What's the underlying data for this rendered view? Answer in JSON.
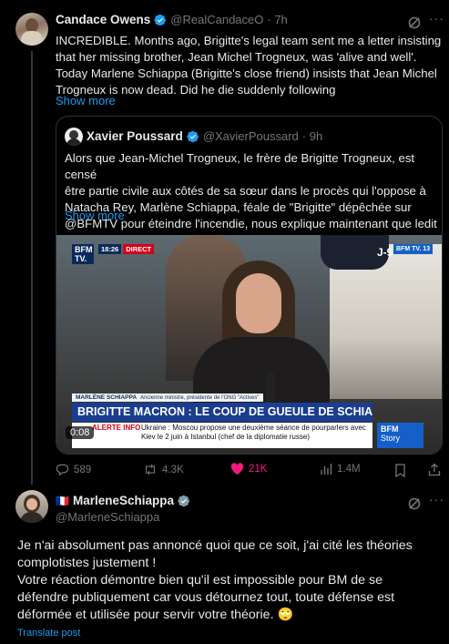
{
  "tweet": {
    "author_name": "Candace Owens",
    "author_handle": "@RealCandaceO",
    "time": "· 7h",
    "text_lines": [
      "INCREDIBLE. Months ago, Brigitte's legal team sent me a letter insisting",
      "that her missing brother, Jean Michel Trogneux, was 'alive and well'.",
      "Today Marlene Schiappa (Brigitte's close friend) insists that Jean Michel",
      "Trogneux is now dead. Did he die suddenly following"
    ],
    "show_more": "Show more",
    "quote": {
      "author_name": "Xavier Poussard",
      "author_handle": "@XavierPoussard",
      "time": "· 9h",
      "text_lines": [
        "Alors que Jean-Michel Trogneux, le frère de Brigitte Trogneux, est censé",
        "être partie civile aux côtés de sa sœur dans le procès qui l'oppose à",
        "Natacha Rey, Marlène Schiappa, féale de \"Brigitte\" dépêchée sur",
        "@BFMTV pour éteindre l'incendie, nous explique maintenant que ledit"
      ],
      "show_more": "Show more",
      "video": {
        "logo": "BFM TV.",
        "time": "18:26",
        "direct": "DIRECT",
        "countdown": "J-9",
        "channel_badge": "BFM TV. 13",
        "lower_name": "MARLÈNE SCHIAPPA",
        "lower_role": "Ancienne ministre, présidente de l'ONG \"Actives\"",
        "headline": "BRIGITTE MACRON : LE COUP DE GUEULE DE SCHIAPPA",
        "alert_label": "ALERTE INFO",
        "ticker": "Ukraine : Moscou propose une deuxième séance de pourparlers avec Kiev le 2 juin à Istanbul (chef de la diplomatie russe)",
        "corner_logo": "BFM",
        "corner_sub": "Story",
        "duration": "0:08"
      }
    },
    "actions": {
      "replies": "589",
      "reposts": "4.3K",
      "likes": "21K",
      "views": "1.4M"
    }
  },
  "reply": {
    "flag": "🇫🇷",
    "author_name": "MarleneSchiappa",
    "author_handle": "@MarleneSchiappa",
    "text_lines": [
      "Je n'ai absolument pas annoncé quoi que ce soit, j'ai cité les théories",
      "complotistes justement !",
      "Votre réaction démontre bien qu'il est impossible pour BM de se",
      "défendre publiquement car vous détournez tout, toute défense est",
      "déformée et utilisée pour servir votre théorie. 🙄"
    ],
    "translate": "Translate post"
  },
  "colors": {
    "background": "#000000",
    "text": "#e7e9ea",
    "muted": "#71767b",
    "link": "#1d9bf0",
    "like": "#f91880",
    "border": "#2f3336"
  }
}
